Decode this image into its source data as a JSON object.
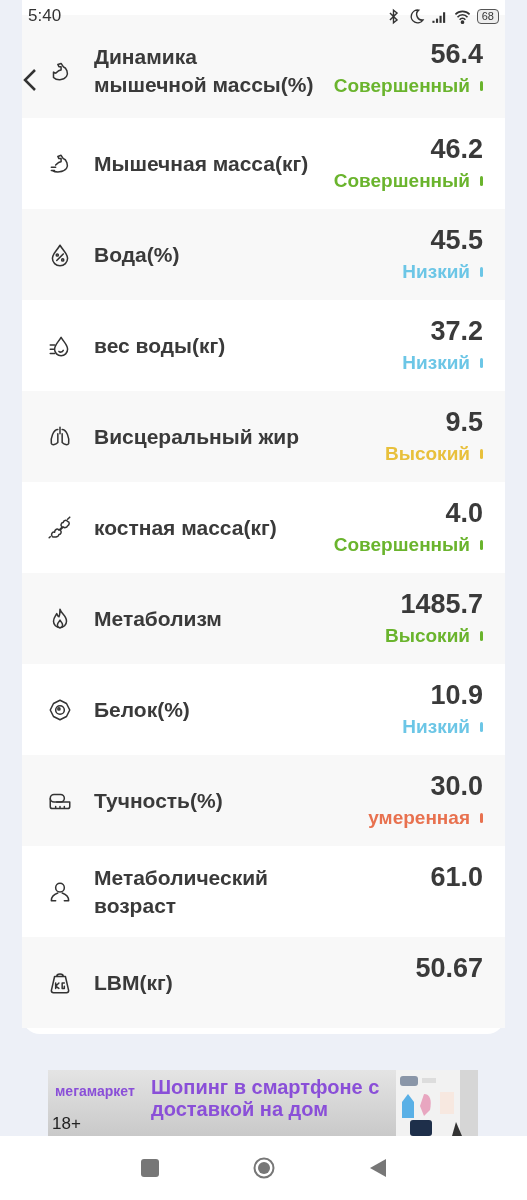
{
  "status_bar": {
    "time": "5:40",
    "battery": "68"
  },
  "metrics": [
    {
      "name": "Динамика мышечной массы(%)",
      "value": "56.4",
      "status": "Совершенный",
      "color": "#6ab42d"
    },
    {
      "name": "Мышечная масса(кг)",
      "value": "46.2",
      "status": "Совершенный",
      "color": "#6ab42d"
    },
    {
      "name": "Вода(%)",
      "value": "45.5",
      "status": "Низкий",
      "color": "#6cc6e6"
    },
    {
      "name": "вес воды(кг)",
      "value": "37.2",
      "status": "Низкий",
      "color": "#6cc6e6"
    },
    {
      "name": "Висцеральный жир",
      "value": "9.5",
      "status": "Высокий",
      "color": "#e8c03c"
    },
    {
      "name": "костная масса(кг)",
      "value": "4.0",
      "status": "Совершенный",
      "color": "#6ab42d"
    },
    {
      "name": "Метаболизм",
      "value": "1485.7",
      "status": "Высокий",
      "color": "#6ab42d"
    },
    {
      "name": "Белок(%)",
      "value": "10.9",
      "status": "Низкий",
      "color": "#6cc6e6"
    },
    {
      "name": "Тучность(%)",
      "value": "30.0",
      "status": "умеренная",
      "color": "#e8714f"
    },
    {
      "name": "Метаболический возраст",
      "value": "61.0"
    },
    {
      "name": "LBM(кг)",
      "value": "50.67"
    }
  ],
  "ad": {
    "brand": "мегамаркет",
    "headline": "Шопинг в смартфоне с доставкой на дом",
    "age": "18+"
  }
}
